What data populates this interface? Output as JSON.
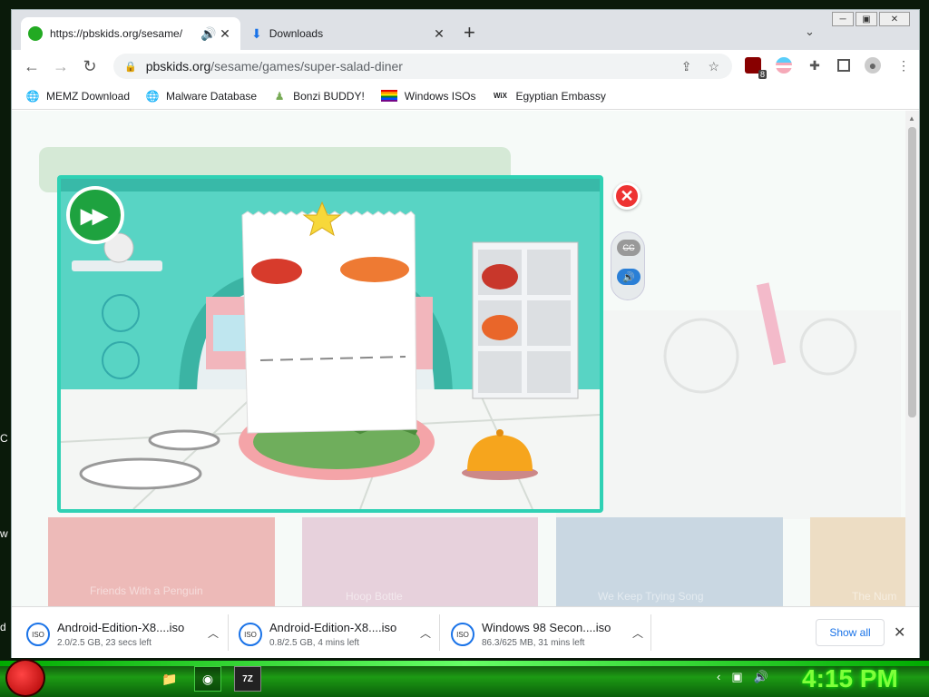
{
  "window": {
    "min": "─",
    "max": "▣",
    "close": "✕"
  },
  "tabs": [
    {
      "title": "https://pbskids.org/sesame/",
      "audio": "🔊",
      "close": "✕"
    },
    {
      "title": "Downloads",
      "close": "✕"
    }
  ],
  "new_tab": "+",
  "tab_search": "⌄",
  "nav": {
    "back": "←",
    "forward": "→",
    "reload": "↻"
  },
  "address": {
    "host": "pbskids.org",
    "path": "/sesame/games/super-salad-diner"
  },
  "omni_actions": {
    "share": "⇪",
    "star": "☆"
  },
  "extensions": {
    "badge": "8"
  },
  "bookmarks": [
    {
      "label": "MEMZ Download",
      "icon": "globe-icon"
    },
    {
      "label": "Malware Database",
      "icon": "globe-icon"
    },
    {
      "label": "Bonzi BUDDY!",
      "icon": "bonzi-icon"
    },
    {
      "label": "Windows ISOs",
      "icon": "rainbow-flag-icon"
    },
    {
      "label": "Egyptian Embassy",
      "icon": "wix-icon",
      "icon_text": "WiX"
    }
  ],
  "game": {
    "close": "✕",
    "cc": "CC",
    "sound": "🔊",
    "skip": "▶▶"
  },
  "background_tiles": [
    "Friends With a Penguin",
    "Hoop Bottle",
    "We Keep Trying Song",
    "The Num"
  ],
  "downloads": [
    {
      "name": "Android-Edition-X8....iso",
      "status": "2.0/2.5 GB, 23 secs left",
      "icon": "ISO"
    },
    {
      "name": "Android-Edition-X8....iso",
      "status": "0.8/2.5 GB, 4 mins left",
      "icon": "ISO"
    },
    {
      "name": "Windows 98 Secon....iso",
      "status": "86.3/625 MB, 31 mins left",
      "icon": "ISO"
    }
  ],
  "downloads_show_all": "Show all",
  "downloads_close": "✕",
  "taskbar": {
    "clock": "4:15 PM",
    "app_winrar": "7Z"
  },
  "side_chars": [
    "C",
    "w",
    "d"
  ]
}
